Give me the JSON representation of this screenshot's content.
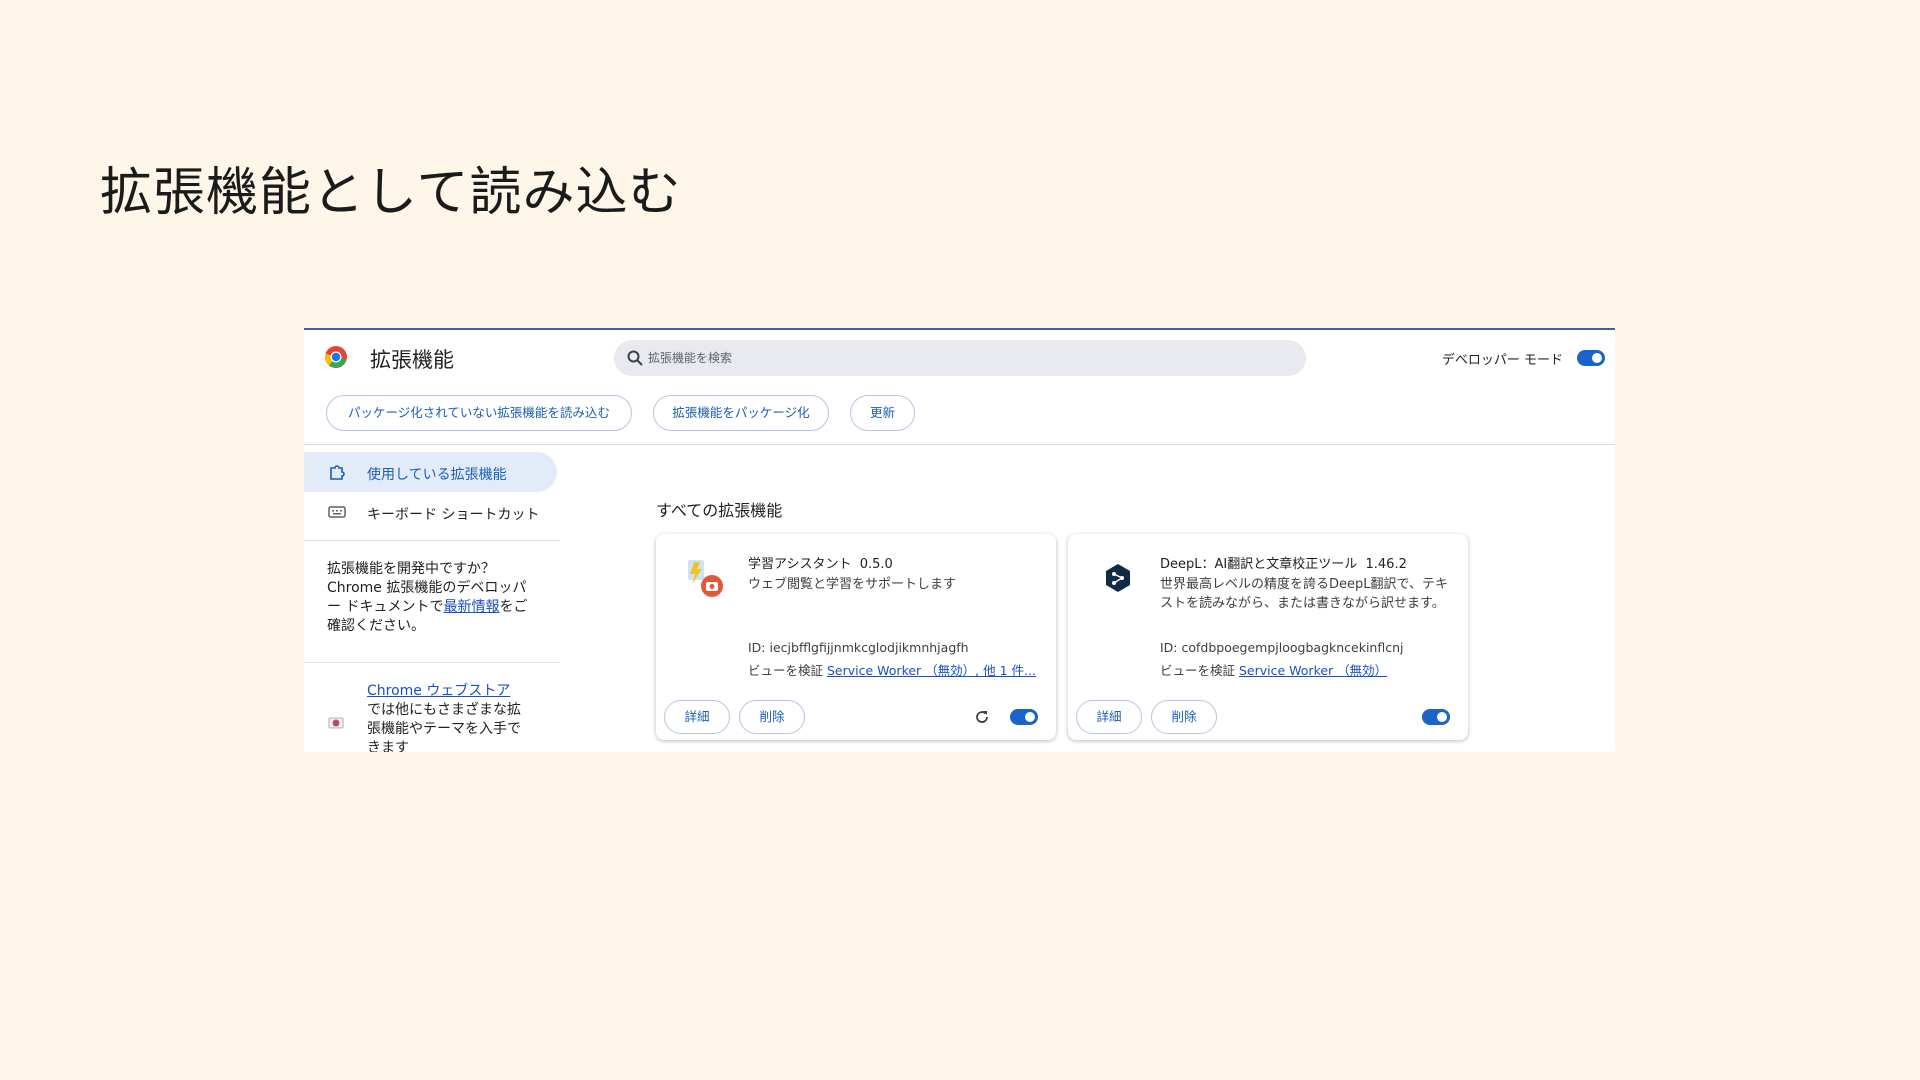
{
  "slide": {
    "title": "拡張機能として読み込む"
  },
  "header": {
    "title": "拡張機能",
    "search_placeholder": "拡張機能を検索",
    "dev_mode_label": "デベロッパー モード",
    "dev_mode_on": true
  },
  "toolbar": {
    "load_unpacked": "パッケージ化されていない拡張機能を読み込む",
    "pack": "拡張機能をパッケージ化",
    "update": "更新"
  },
  "sidebar": {
    "items": [
      {
        "label": "使用している拡張機能",
        "icon": "puzzle-icon",
        "active": true
      },
      {
        "label": "キーボード ショートカット",
        "icon": "keyboard-icon",
        "active": false
      }
    ],
    "dev_note": {
      "before": "拡張機能を開発中ですか？Chrome 拡張機能のデベロッパー ドキュメントで",
      "link": "最新情報",
      "after": "をご確認ください。"
    },
    "store_note": {
      "link": "Chrome ウェブストア",
      "after": " では他にもさまざまな拡張機能やテーマを入手できます"
    }
  },
  "main": {
    "section_title": "すべての拡張機能",
    "cards": [
      {
        "name": "学習アシスタント",
        "version": "0.5.0",
        "description": "ウェブ閲覧と学習をサポートします",
        "id_text": "ID: iecjbfflgfijjnmkcglodjikmnhjagfh",
        "view_prefix": "ビューを検証 ",
        "view_link": "Service Worker （無効）, 他 1 件...",
        "details": "詳細",
        "remove": "削除",
        "enabled": true,
        "has_reload": true
      },
      {
        "name": "DeepL：AI翻訳と文章校正ツール",
        "version": "1.46.2",
        "description": "世界最高レベルの精度を誇るDeepL翻訳で、テキストを読みながら、または書きながら訳せます。",
        "id_text": "ID: cofdbpoegempjloogbagkncekinflcnj",
        "view_prefix": "ビューを検証 ",
        "view_link": "Service Worker （無効）",
        "details": "詳細",
        "remove": "削除",
        "enabled": true,
        "has_reload": false
      }
    ]
  },
  "colors": {
    "accent": "#1a64c9",
    "background": "#fdf6e9",
    "nav_active": "#e3ebf8"
  }
}
